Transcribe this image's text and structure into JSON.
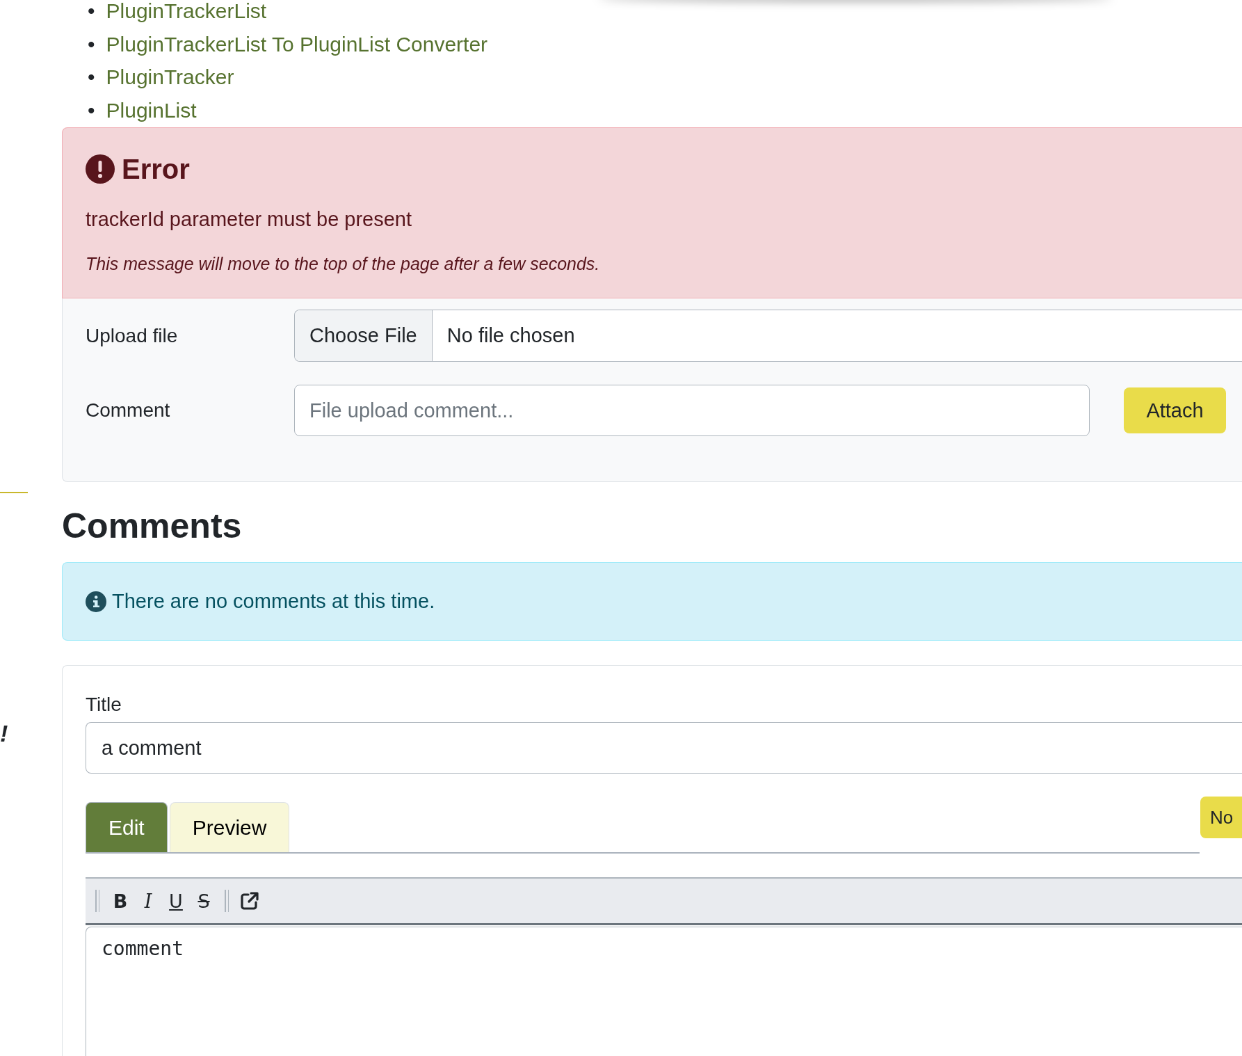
{
  "side": {
    "mark": "!"
  },
  "links": {
    "marker": "•",
    "items": [
      "PluginTrackerList",
      "PluginTrackerList To PluginList Converter",
      "PluginTracker",
      "PluginList"
    ]
  },
  "error": {
    "title": "Error",
    "message": "trackerId parameter must be present",
    "note": "This message will move to the top of the page after a few seconds."
  },
  "upload": {
    "file_label": "Upload file",
    "file_button": "Choose File",
    "file_status": "No file chosen",
    "comment_label": "Comment",
    "comment_placeholder": "File upload comment...",
    "attach": "Attach"
  },
  "comments": {
    "heading": "Comments",
    "info": "There are no comments at this time."
  },
  "form": {
    "title_label": "Title",
    "title_value": "a comment",
    "tabs": [
      {
        "label": "Edit",
        "selected": true
      },
      {
        "label": "Preview",
        "selected": false
      }
    ],
    "side_button": "No",
    "toolbar": [
      {
        "kind": "bold",
        "label": "B"
      },
      {
        "kind": "italic",
        "label": "I"
      },
      {
        "kind": "underline",
        "label": "U"
      },
      {
        "kind": "strike",
        "label": "S"
      },
      {
        "kind": "separator"
      },
      {
        "kind": "link"
      }
    ],
    "body": "comment"
  }
}
